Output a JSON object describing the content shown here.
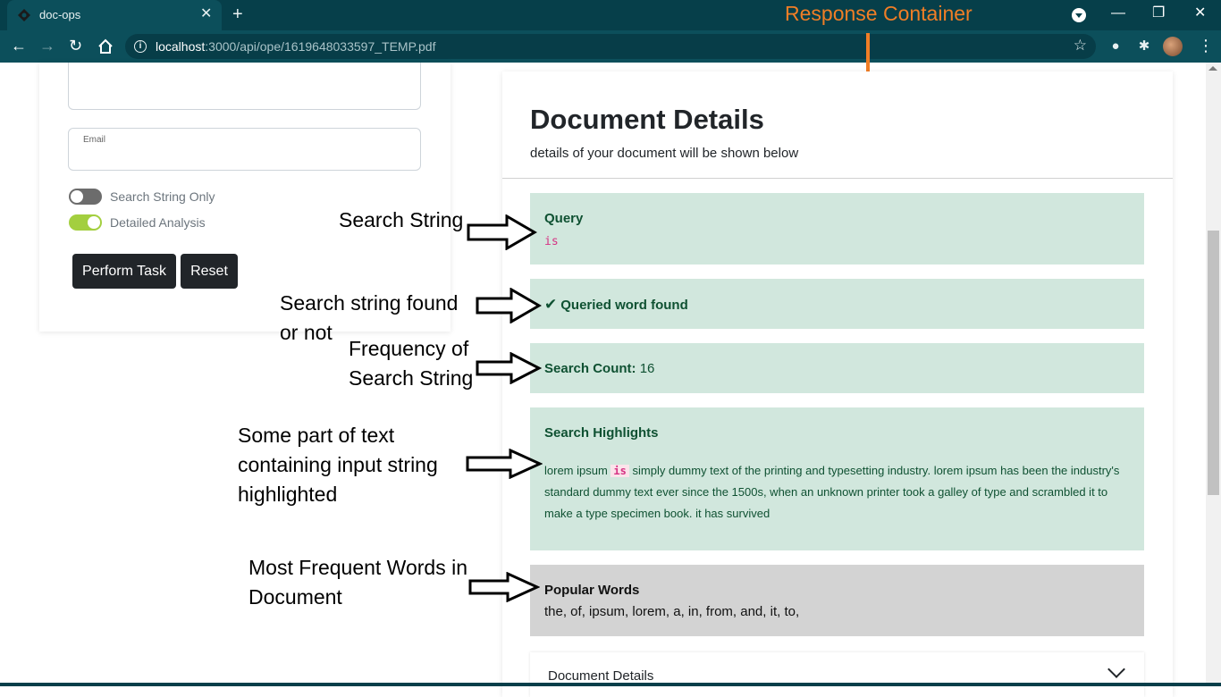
{
  "browser": {
    "tab_title": "doc-ops",
    "tab_close": "✕",
    "new_tab": "+",
    "url_host": "localhost",
    "url_path": ":3000/api/ope/1619648033597_TEMP.pdf",
    "window_minimize": "—",
    "window_restore": "❐",
    "window_close": "✕"
  },
  "form": {
    "email_label": "Email",
    "toggles": [
      {
        "label": "Search String Only",
        "on": false
      },
      {
        "label": "Detailed Analysis",
        "on": true
      }
    ],
    "perform_button": "Perform Task",
    "reset_button": "Reset"
  },
  "response": {
    "title": "Document Details",
    "subtitle": "details of your document will be shown below",
    "query_heading": "Query",
    "query_value": "is",
    "found_text": "Queried word found",
    "count_label": "Search Count:",
    "count_value": "16",
    "highlights_heading": "Search Highlights",
    "highlight_before": "lorem ipsum",
    "highlight_word": "is",
    "highlight_after": "simply dummy text of the printing and typesetting industry. lorem ipsum has been the industry's standard dummy text ever since the 1500s, when an unknown printer took a galley of type and scrambled it to make a type specimen book. it has survived",
    "popular_heading": "Popular Words",
    "popular_words": "the, of, ipsum, lorem, a, in, from, and, it, to,",
    "accordion_label": "Document Details"
  },
  "annotations": {
    "response_container": "Response Container",
    "search_string": "Search String",
    "found_line1": "Search string found",
    "found_line2": "or not",
    "freq_line1": "Frequency of",
    "freq_line2": "Search String",
    "highlight_line1": "Some part of text",
    "highlight_line2": "containing input string",
    "highlight_line3": "highlighted",
    "popular_line1": "Most Frequent Words in",
    "popular_line2": "Document"
  },
  "colors": {
    "chrome": "#063f4a",
    "success_bg": "#d1e7dd",
    "success_text": "#0f5132",
    "toggle_on": "#a3cf3f",
    "annotation_accent": "#f07e26"
  }
}
